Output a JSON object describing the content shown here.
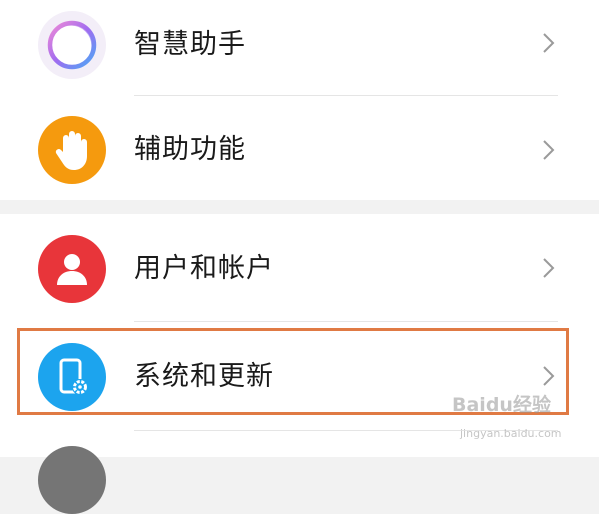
{
  "settings": {
    "items": [
      {
        "label": "智慧助手",
        "icon": "assistant-ring-icon"
      },
      {
        "label": "辅助功能",
        "icon": "hand-icon",
        "icon_color": "#f59a0e"
      },
      {
        "label": "用户和帐户",
        "icon": "user-icon",
        "icon_color": "#e8353a"
      },
      {
        "label": "系统和更新",
        "icon": "phone-settings-icon",
        "icon_color": "#1ca4ee",
        "highlighted": true
      }
    ],
    "highlight_color": "#e07a44"
  },
  "watermark": {
    "brand": "Baidu经验",
    "url": "jingyan.baidu.com"
  }
}
